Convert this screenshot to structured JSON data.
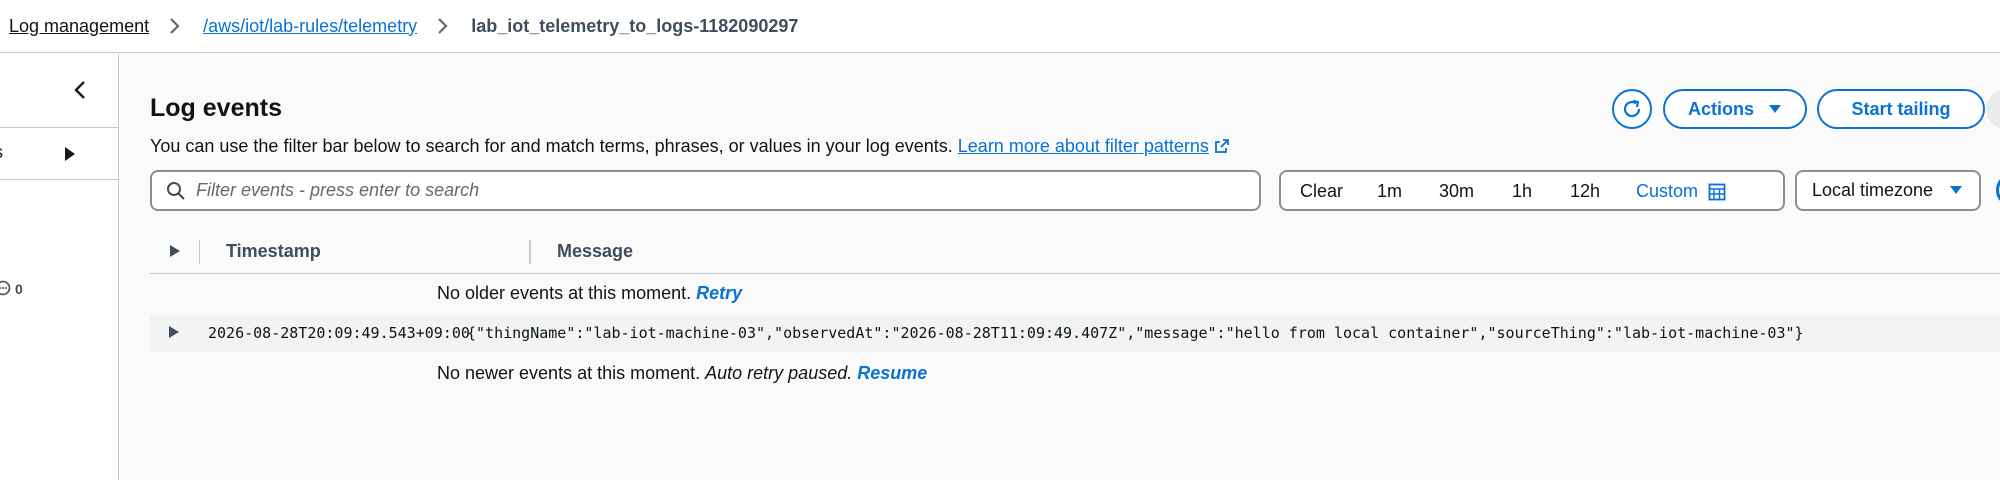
{
  "breadcrumb": {
    "items": [
      "Log management",
      "/aws/iot/lab-rules/telemetry"
    ],
    "current": "lab_iot_telemetry_to_logs-1182090297"
  },
  "left_panel": {
    "item_label": "s",
    "count": "0"
  },
  "log_events": {
    "title": "Log events",
    "description": "You can use the filter bar below to search for and match terms, phrases, or values in your log events.",
    "learn_more_link": "Learn more about filter patterns",
    "actions_label": "Actions",
    "start_tailing_label": "Start tailing",
    "filter_placeholder": "Filter events - press enter to search",
    "time_ranges": [
      "Clear",
      "1m",
      "30m",
      "1h",
      "12h",
      "Custom"
    ],
    "timezone": "Local timezone"
  },
  "table": {
    "columns": [
      "Timestamp",
      "Message"
    ],
    "older_note": "No older events at this moment.",
    "older_retry": "Retry",
    "events": [
      {
        "timestamp": "2026-08-28T20:09:49.543+09:00",
        "message": "{\"thingName\":\"lab-iot-machine-03\",\"observedAt\":\"2026-08-28T11:09:49.407Z\",\"message\":\"hello from local container\",\"sourceThing\":\"lab-iot-machine-03\"}"
      }
    ],
    "newer_note": "No newer events at this moment.",
    "newer_paused": "Auto retry paused.",
    "newer_resume": "Resume"
  },
  "colors": {
    "accent": "#0972d3",
    "text": "#0f141a",
    "border": "#8c8c94",
    "row_bg": "#f2f3f3"
  }
}
